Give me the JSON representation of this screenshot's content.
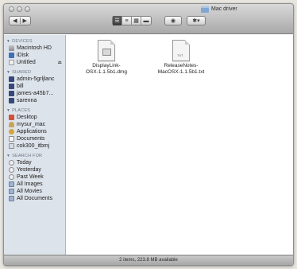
{
  "window": {
    "title": "Mac driver"
  },
  "toolbar": {
    "back_icon": "◀",
    "forward_icon": "▶",
    "view_icons": [
      "☰",
      "≡",
      "▦",
      "▬"
    ],
    "eye_icon": "◉",
    "action_icon": "✱▾"
  },
  "sidebar": {
    "sections": [
      {
        "header": "DEVICES",
        "items": [
          {
            "label": "Macintosh HD",
            "icon": "hd"
          },
          {
            "label": "iDisk",
            "icon": "idisk"
          },
          {
            "label": "Untitled",
            "icon": "untitled",
            "eject": "⏏"
          }
        ]
      },
      {
        "header": "SHARED",
        "items": [
          {
            "label": "admin-5grljlanc",
            "icon": "network"
          },
          {
            "label": "bill",
            "icon": "network"
          },
          {
            "label": "james-a45b7...",
            "icon": "network"
          },
          {
            "label": "sarenna",
            "icon": "network"
          }
        ]
      },
      {
        "header": "PLACES",
        "items": [
          {
            "label": "Desktop",
            "icon": "desktop"
          },
          {
            "label": "mysur_mac",
            "icon": "home"
          },
          {
            "label": "Applications",
            "icon": "apps"
          },
          {
            "label": "Documents",
            "icon": "docs"
          },
          {
            "label": "cok300_itbmj",
            "icon": "folder"
          }
        ]
      },
      {
        "header": "SEARCH FOR",
        "items": [
          {
            "label": "Today",
            "icon": "clock"
          },
          {
            "label": "Yesterday",
            "icon": "clock"
          },
          {
            "label": "Past Week",
            "icon": "clock"
          },
          {
            "label": "All Images",
            "icon": "smart"
          },
          {
            "label": "All Movies",
            "icon": "smart"
          },
          {
            "label": "All Documents",
            "icon": "smart"
          }
        ]
      }
    ]
  },
  "files": [
    {
      "name": "DisplayLink-OSX-1.1.5b1.dmg",
      "line1": "DisplayLink-",
      "line2": "OSX-1.1.5b1.dmg",
      "type": "dmg"
    },
    {
      "name": "ReleaseNotes-MacOSX-1.1.5b1.txt",
      "line1": "ReleaseNotes-",
      "line2": "MacOSX-1.1.5b1.txt",
      "type": "txt",
      "badge": "TXT"
    }
  ],
  "status": {
    "text": "2 items, 223.8 MB available"
  }
}
